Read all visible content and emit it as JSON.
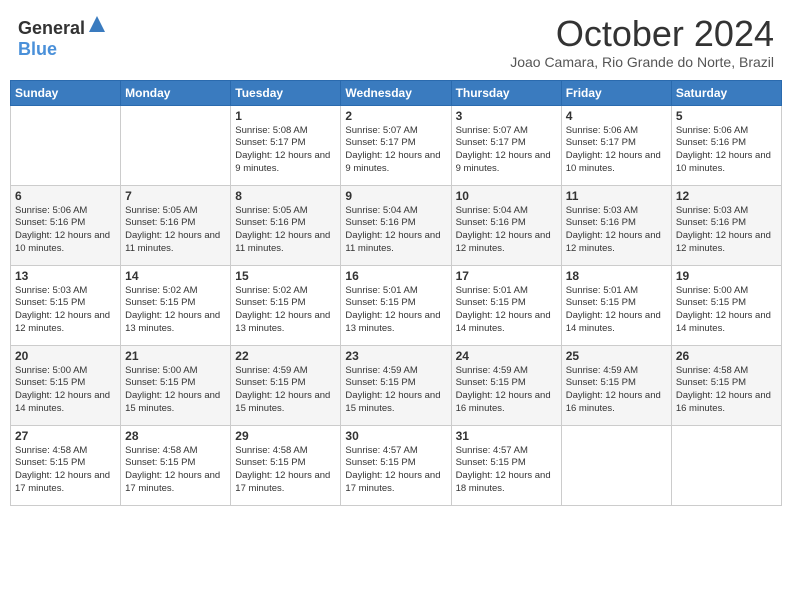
{
  "header": {
    "logo_general": "General",
    "logo_blue": "Blue",
    "month_title": "October 2024",
    "subtitle": "Joao Camara, Rio Grande do Norte, Brazil"
  },
  "days_of_week": [
    "Sunday",
    "Monday",
    "Tuesday",
    "Wednesday",
    "Thursday",
    "Friday",
    "Saturday"
  ],
  "weeks": [
    [
      {
        "day": "",
        "info": ""
      },
      {
        "day": "",
        "info": ""
      },
      {
        "day": "1",
        "info": "Sunrise: 5:08 AM\nSunset: 5:17 PM\nDaylight: 12 hours and 9 minutes."
      },
      {
        "day": "2",
        "info": "Sunrise: 5:07 AM\nSunset: 5:17 PM\nDaylight: 12 hours and 9 minutes."
      },
      {
        "day": "3",
        "info": "Sunrise: 5:07 AM\nSunset: 5:17 PM\nDaylight: 12 hours and 9 minutes."
      },
      {
        "day": "4",
        "info": "Sunrise: 5:06 AM\nSunset: 5:17 PM\nDaylight: 12 hours and 10 minutes."
      },
      {
        "day": "5",
        "info": "Sunrise: 5:06 AM\nSunset: 5:16 PM\nDaylight: 12 hours and 10 minutes."
      }
    ],
    [
      {
        "day": "6",
        "info": "Sunrise: 5:06 AM\nSunset: 5:16 PM\nDaylight: 12 hours and 10 minutes."
      },
      {
        "day": "7",
        "info": "Sunrise: 5:05 AM\nSunset: 5:16 PM\nDaylight: 12 hours and 11 minutes."
      },
      {
        "day": "8",
        "info": "Sunrise: 5:05 AM\nSunset: 5:16 PM\nDaylight: 12 hours and 11 minutes."
      },
      {
        "day": "9",
        "info": "Sunrise: 5:04 AM\nSunset: 5:16 PM\nDaylight: 12 hours and 11 minutes."
      },
      {
        "day": "10",
        "info": "Sunrise: 5:04 AM\nSunset: 5:16 PM\nDaylight: 12 hours and 12 minutes."
      },
      {
        "day": "11",
        "info": "Sunrise: 5:03 AM\nSunset: 5:16 PM\nDaylight: 12 hours and 12 minutes."
      },
      {
        "day": "12",
        "info": "Sunrise: 5:03 AM\nSunset: 5:16 PM\nDaylight: 12 hours and 12 minutes."
      }
    ],
    [
      {
        "day": "13",
        "info": "Sunrise: 5:03 AM\nSunset: 5:15 PM\nDaylight: 12 hours and 12 minutes."
      },
      {
        "day": "14",
        "info": "Sunrise: 5:02 AM\nSunset: 5:15 PM\nDaylight: 12 hours and 13 minutes."
      },
      {
        "day": "15",
        "info": "Sunrise: 5:02 AM\nSunset: 5:15 PM\nDaylight: 12 hours and 13 minutes."
      },
      {
        "day": "16",
        "info": "Sunrise: 5:01 AM\nSunset: 5:15 PM\nDaylight: 12 hours and 13 minutes."
      },
      {
        "day": "17",
        "info": "Sunrise: 5:01 AM\nSunset: 5:15 PM\nDaylight: 12 hours and 14 minutes."
      },
      {
        "day": "18",
        "info": "Sunrise: 5:01 AM\nSunset: 5:15 PM\nDaylight: 12 hours and 14 minutes."
      },
      {
        "day": "19",
        "info": "Sunrise: 5:00 AM\nSunset: 5:15 PM\nDaylight: 12 hours and 14 minutes."
      }
    ],
    [
      {
        "day": "20",
        "info": "Sunrise: 5:00 AM\nSunset: 5:15 PM\nDaylight: 12 hours and 14 minutes."
      },
      {
        "day": "21",
        "info": "Sunrise: 5:00 AM\nSunset: 5:15 PM\nDaylight: 12 hours and 15 minutes."
      },
      {
        "day": "22",
        "info": "Sunrise: 4:59 AM\nSunset: 5:15 PM\nDaylight: 12 hours and 15 minutes."
      },
      {
        "day": "23",
        "info": "Sunrise: 4:59 AM\nSunset: 5:15 PM\nDaylight: 12 hours and 15 minutes."
      },
      {
        "day": "24",
        "info": "Sunrise: 4:59 AM\nSunset: 5:15 PM\nDaylight: 12 hours and 16 minutes."
      },
      {
        "day": "25",
        "info": "Sunrise: 4:59 AM\nSunset: 5:15 PM\nDaylight: 12 hours and 16 minutes."
      },
      {
        "day": "26",
        "info": "Sunrise: 4:58 AM\nSunset: 5:15 PM\nDaylight: 12 hours and 16 minutes."
      }
    ],
    [
      {
        "day": "27",
        "info": "Sunrise: 4:58 AM\nSunset: 5:15 PM\nDaylight: 12 hours and 17 minutes."
      },
      {
        "day": "28",
        "info": "Sunrise: 4:58 AM\nSunset: 5:15 PM\nDaylight: 12 hours and 17 minutes."
      },
      {
        "day": "29",
        "info": "Sunrise: 4:58 AM\nSunset: 5:15 PM\nDaylight: 12 hours and 17 minutes."
      },
      {
        "day": "30",
        "info": "Sunrise: 4:57 AM\nSunset: 5:15 PM\nDaylight: 12 hours and 17 minutes."
      },
      {
        "day": "31",
        "info": "Sunrise: 4:57 AM\nSunset: 5:15 PM\nDaylight: 12 hours and 18 minutes."
      },
      {
        "day": "",
        "info": ""
      },
      {
        "day": "",
        "info": ""
      }
    ]
  ]
}
